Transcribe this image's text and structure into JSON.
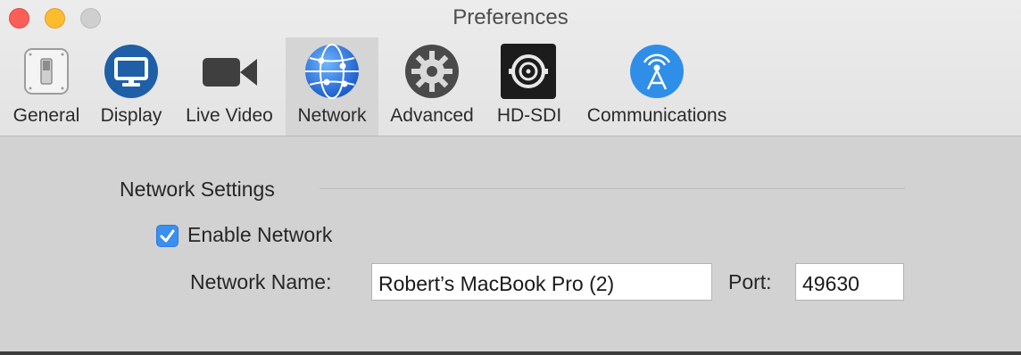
{
  "window": {
    "title": "Preferences"
  },
  "tabs": [
    {
      "label": "General",
      "icon": "switch-icon",
      "active": false
    },
    {
      "label": "Display",
      "icon": "display-icon",
      "active": false
    },
    {
      "label": "Live Video",
      "icon": "video-camera-icon",
      "active": false
    },
    {
      "label": "Network",
      "icon": "globe-network-icon",
      "active": true
    },
    {
      "label": "Advanced",
      "icon": "gear-icon",
      "active": false
    },
    {
      "label": "HD-SDI",
      "icon": "bnc-connector-icon",
      "active": false
    },
    {
      "label": "Communications",
      "icon": "antenna-icon",
      "active": false
    }
  ],
  "network_settings": {
    "section_title": "Network Settings",
    "enable_network": {
      "label": "Enable Network",
      "checked": true
    },
    "network_name": {
      "label": "Network Name:",
      "value": "Robert’s MacBook Pro (2)"
    },
    "port": {
      "label": "Port:",
      "value": "49630"
    }
  },
  "colors": {
    "accent": "#3b8fef",
    "display_icon_blue": "#1f5fa8",
    "communications_blue": "#2f8ee8",
    "close": "#fc5f57",
    "minimize": "#fdbc2e"
  }
}
